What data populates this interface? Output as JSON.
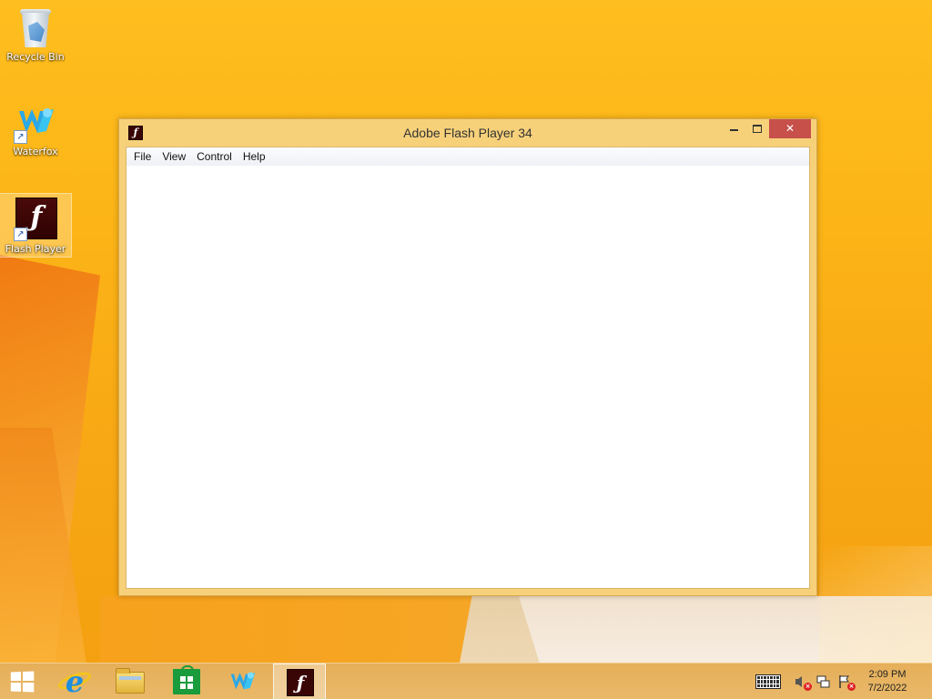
{
  "desktop": {
    "icons": [
      {
        "label": "Recycle Bin",
        "icon": "recycle-bin-icon"
      },
      {
        "label": "Waterfox",
        "icon": "waterfox-icon"
      },
      {
        "label": "Flash Player",
        "icon": "flash-player-icon",
        "selected": true
      }
    ]
  },
  "window": {
    "title": "Adobe Flash Player 34",
    "app_icon": "flash-icon",
    "controls": {
      "minimize": "minimize",
      "maximize": "maximize",
      "close": "✕"
    },
    "menu": [
      {
        "label": "File"
      },
      {
        "label": "View"
      },
      {
        "label": "Control"
      },
      {
        "label": "Help"
      }
    ]
  },
  "taskbar": {
    "pinned": [
      {
        "name": "start",
        "icon": "windows-logo-icon"
      },
      {
        "name": "internet-explorer",
        "icon": "internet-explorer-icon"
      },
      {
        "name": "file-explorer",
        "icon": "folder-icon"
      },
      {
        "name": "store",
        "icon": "store-icon"
      },
      {
        "name": "waterfox",
        "icon": "waterfox-icon"
      },
      {
        "name": "flash-player",
        "icon": "flash-icon",
        "active": true
      }
    ],
    "tray": {
      "icons": [
        "keyboard-icon",
        "volume-muted-icon",
        "network-icon",
        "action-center-icon"
      ],
      "time": "2:09 PM",
      "date": "7/2/2022"
    }
  },
  "colors": {
    "wallpaper": "#fcb517",
    "window_frame": "#f7d17a",
    "close_button": "#c7504b",
    "flash_red": "#3a0505"
  }
}
